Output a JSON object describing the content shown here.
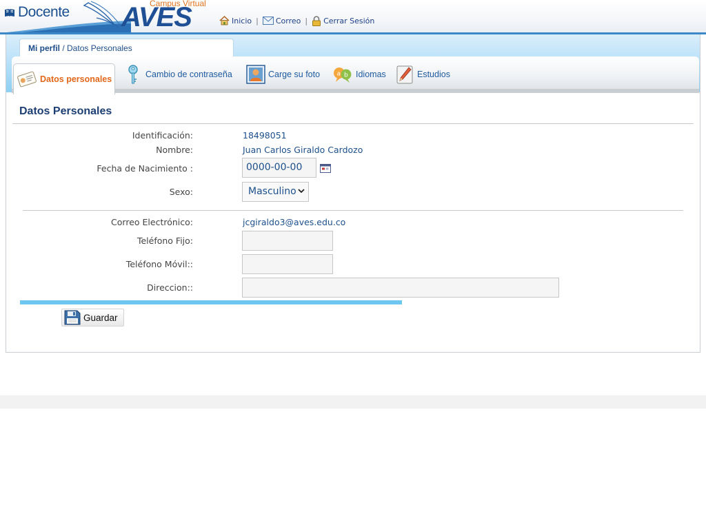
{
  "header": {
    "brand": "Docente",
    "campus_label": "Campus Virtual",
    "logo_text": "AVES",
    "links": [
      {
        "label": "Inicio",
        "icon": "home-icon"
      },
      {
        "label": "Correo",
        "icon": "mail-icon"
      },
      {
        "label": "Cerrar Sesión",
        "icon": "lock-icon"
      }
    ],
    "separator": "|"
  },
  "breadcrumb": {
    "root": "Mi perfil",
    "current": " / Datos Personales"
  },
  "tabs": [
    {
      "label": "Datos personales",
      "icon": "id-card-icon",
      "active": true
    },
    {
      "label": "Cambio de contraseña",
      "icon": "key-icon",
      "active": false
    },
    {
      "label": "Carge su foto",
      "icon": "user-photo-icon",
      "active": false
    },
    {
      "label": "Idiomas",
      "icon": "languages-icon",
      "active": false
    },
    {
      "label": "Estudios",
      "icon": "pencil-icon",
      "active": false
    }
  ],
  "section_title": "Datos Personales",
  "form": {
    "identificacion": {
      "label": "Identificación:",
      "value": "18498051"
    },
    "nombre": {
      "label": "Nombre:",
      "value": "Juan Carlos Giraldo Cardozo"
    },
    "fecha": {
      "label": "Fecha de Nacimiento :",
      "value": "0000-00-00"
    },
    "sexo": {
      "label": "Sexo:",
      "value": "Masculino"
    },
    "correo": {
      "label": "Correo Electrónico:",
      "value": "jcgiraldo3@aves.edu.co"
    },
    "telefono_fijo": {
      "label": "Teléfono Fijo:",
      "value": ""
    },
    "telefono_movil": {
      "label": "Teléfono Móvil::",
      "value": ""
    },
    "direccion": {
      "label": "Direccion::",
      "value": ""
    }
  },
  "save_button": "Guardar",
  "colors": {
    "brand_blue": "#1f4f95",
    "accent_orange": "#e2731c",
    "link_blue": "#1d5aa0",
    "progress": "#6cc6f0"
  }
}
